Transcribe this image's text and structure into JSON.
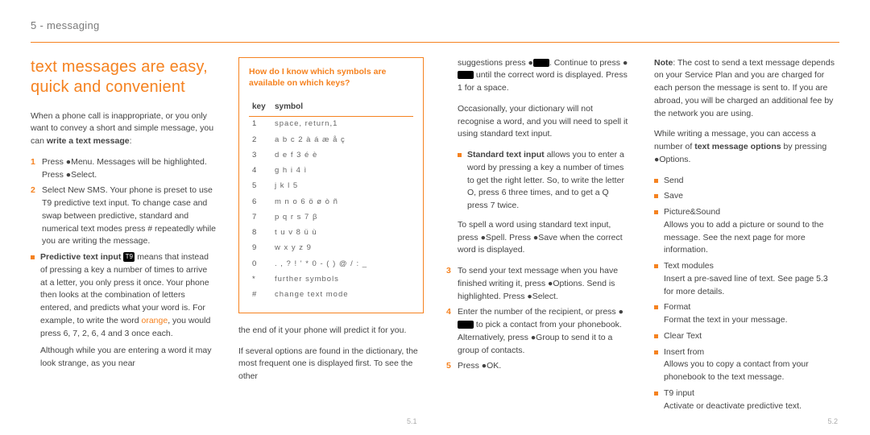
{
  "header": "5 - messaging",
  "title": "text messages are easy, quick and convenient",
  "col1": {
    "intro_a": "When a phone call is inappropriate, or you only want to convey a short and simple message, you can ",
    "intro_b": "write a text message",
    "intro_c": ":",
    "step1": "Press ●Menu. Messages will be highlighted. Press ●Select.",
    "step2": "Select New SMS. Your phone is preset to use T9 predictive text input. To change case and swap between predictive, standard and numerical text modes press # repeatedly while you are writing the message.",
    "pred_lead": "Predictive text input",
    "pred_body": " means that instead of pressing a key a number of times to arrive at a letter, you only press it once. Your phone then looks at the combination of letters entered, and predicts what your word is. For example, to write the word ",
    "pred_orange": "orange",
    "pred_tail": ", you would press 6, 7, 2, 6, 4 and 3 once each.",
    "pred_note": "Although while you are entering a word it may look strange, as you near"
  },
  "keybox": {
    "title": "How do I know which symbols are available on which keys?",
    "head_key": "key",
    "head_sym": "symbol",
    "rows": [
      {
        "k": "1",
        "s": "space, return,1"
      },
      {
        "k": "2",
        "s": "a b c 2 à á æ å ç"
      },
      {
        "k": "3",
        "s": "d e f 3 é è"
      },
      {
        "k": "4",
        "s": "g h i 4 ì"
      },
      {
        "k": "5",
        "s": "j k l 5"
      },
      {
        "k": "6",
        "s": "m n o 6 ö ø ò ñ"
      },
      {
        "k": "7",
        "s": "p q r s 7 β"
      },
      {
        "k": "8",
        "s": "t u v 8 ü ù"
      },
      {
        "k": "9",
        "s": "w x y z 9"
      },
      {
        "k": "0",
        "s": ". , ? ! ' * 0 - ( ) @ / : _"
      },
      {
        "k": "*",
        "s": "further symbols"
      },
      {
        "k": "#",
        "s": "change text mode"
      }
    ]
  },
  "col2": {
    "p1": "the end of it your phone will predict it for you.",
    "p2": "If several options are found in the dictionary, the most frequent one is displayed first. To see the other"
  },
  "col3": {
    "p1a": "suggestions press ●",
    "p1b": ". Continue to press ●",
    "p1c": " until the correct word is displayed. Press 1 for a space.",
    "p2": "Occasionally, your dictionary will not recognise a word, and you will need to spell it using standard text input.",
    "std_lead": "Standard text input",
    "std_body": " allows you to enter a word by pressing a key a number of times to get the right letter. So, to write the letter O, press 6 three times, and to get a Q press 7 twice.",
    "p3": "To spell a word using standard text input, press ●Spell. Press ●Save when the correct word is displayed.",
    "step3": "To send your text message when you have finished writing it, press ●Options. Send is highlighted. Press ●Select.",
    "step4a": "Enter the number of the recipient, or press ●",
    "step4b": " to pick a contact from your phonebook. Alternatively, press ●Group to send it to a group of contacts.",
    "step5": "Press ●OK."
  },
  "col4": {
    "note_lead": "Note",
    "note_body": ": The cost to send a text message depends on your Service Plan and you are charged for each person the message is sent to. If you are abroad, you will be charged an additional fee by the network you are using.",
    "p2a": "While writing a message, you can access a number of ",
    "p2b": "text message options",
    "p2c": " by pressing ●Options.",
    "opts": [
      {
        "l": "Send",
        "d": ""
      },
      {
        "l": "Save",
        "d": ""
      },
      {
        "l": "Picture&Sound",
        "d": "Allows you to add a picture or sound to the message. See the next page for more information."
      },
      {
        "l": "Text modules",
        "d": "Insert a pre-saved line of text. See page 5.3 for more details."
      },
      {
        "l": "Format",
        "d": "Format the text in your message."
      },
      {
        "l": "Clear Text",
        "d": ""
      },
      {
        "l": "Insert from",
        "d": "Allows you to copy a contact from your phonebook to the text message."
      },
      {
        "l": "T9 input",
        "d": "Activate or deactivate predictive text."
      }
    ]
  },
  "page_left": "5.1",
  "page_right": "5.2"
}
